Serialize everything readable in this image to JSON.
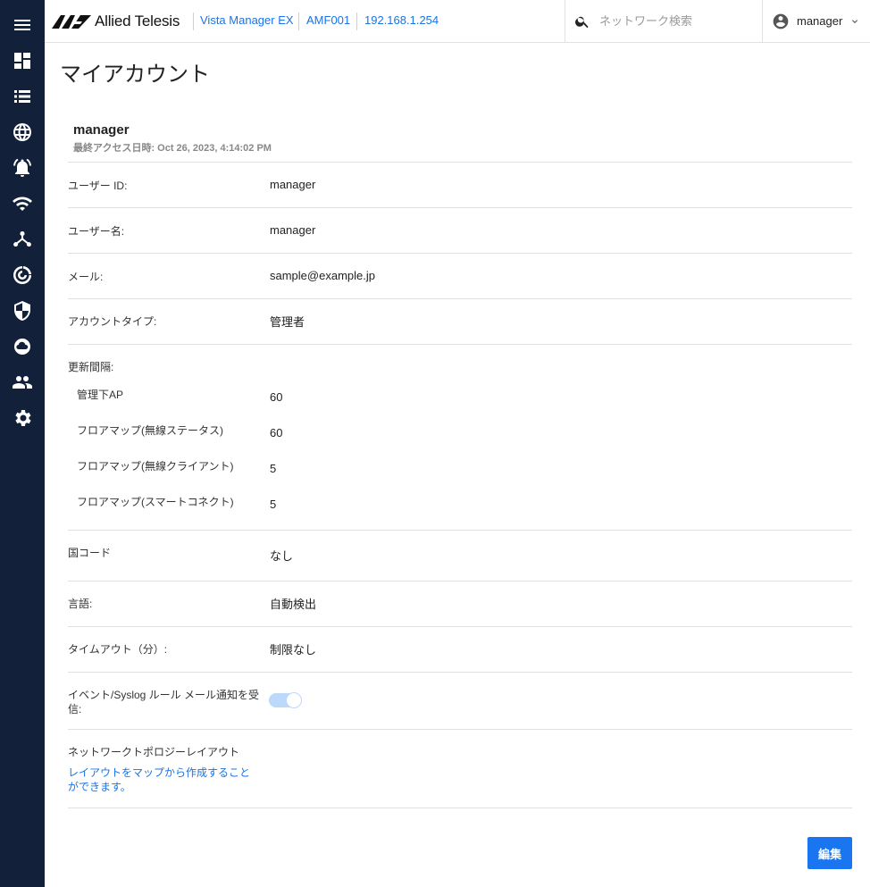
{
  "sidebar": {
    "items": [
      {
        "icon": "menu-icon"
      },
      {
        "icon": "dashboard-icon"
      },
      {
        "icon": "list-icon"
      },
      {
        "icon": "globe-icon"
      },
      {
        "icon": "alarm-icon"
      },
      {
        "icon": "wifi-icon"
      },
      {
        "icon": "topology-icon"
      },
      {
        "icon": "radar-icon"
      },
      {
        "icon": "shield-icon"
      },
      {
        "icon": "cloud-icon"
      },
      {
        "icon": "users-icon"
      },
      {
        "icon": "settings-icon"
      }
    ]
  },
  "header": {
    "logo_text": "Allied Telesis",
    "app_name": "Vista Manager EX",
    "device_name": "AMF001",
    "ip_address": "192.168.1.254",
    "search_placeholder": "ネットワーク検索",
    "user_name": "manager"
  },
  "page": {
    "title": "マイアカウント"
  },
  "profile": {
    "name": "manager",
    "last_access": "最終アクセス日時: Oct 26, 2023, 4:14:02 PM"
  },
  "fields": {
    "user_id_label": "ユーザー ID:",
    "user_id_value": "manager",
    "user_name_label": "ユーザー名:",
    "user_name_value": "manager",
    "email_label": "メール:",
    "email_value": "sample@example.jp",
    "account_type_label": "アカウントタイプ:",
    "account_type_value": "管理者",
    "refresh_label": "更新間隔:",
    "refresh_items": [
      {
        "label": "管理下AP",
        "value": "60"
      },
      {
        "label": "フロアマップ(無線ステータス)",
        "value": "60"
      },
      {
        "label": "フロアマップ(無線クライアント)",
        "value": "5"
      },
      {
        "label": "フロアマップ(スマートコネクト)",
        "value": "5"
      }
    ],
    "country_label": "国コード",
    "country_value": "なし",
    "language_label": "言語:",
    "language_value": "自動検出",
    "timeout_label": "タイムアウト（分）:",
    "timeout_value": "制限なし",
    "notify_label_line1": "イベント/Syslog ルール メール通知を受",
    "notify_label_line2": "信:",
    "notify_enabled": true,
    "topology_label": "ネットワークトポロジーレイアウト",
    "topology_link": "レイアウトをマップから作成することができます。"
  },
  "actions": {
    "edit_label": "編集"
  },
  "colors": {
    "sidebar_bg": "#13203a",
    "link": "#1a73e8",
    "primary_button": "#1976f0",
    "toggle_track": "#bcd8fb"
  }
}
